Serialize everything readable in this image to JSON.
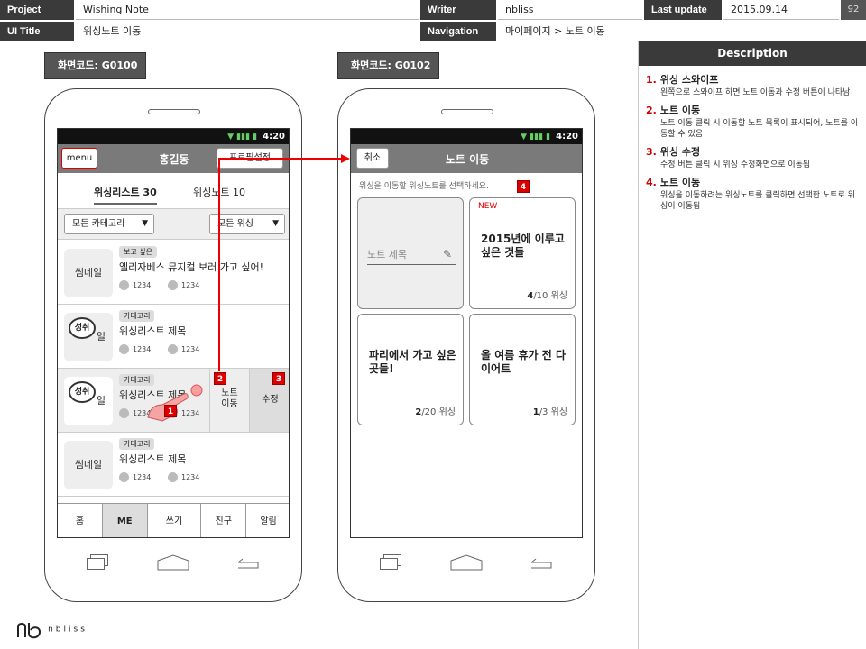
{
  "header": {
    "project_label": "Project",
    "project": "Wishing Note",
    "writer_label": "Writer",
    "writer": "nbliss",
    "lastupdate_label": "Last update",
    "lastupdate": "2015.09.14",
    "page": "92",
    "uititle_label": "UI Title",
    "uititle": "위싱노트 이동",
    "navigation_label": "Navigation",
    "navigation": "마이페이지 > 노트 이동"
  },
  "screen1": {
    "code": "화면코드: G0100",
    "time": "4:20",
    "menu": "menu",
    "name": "홍길동",
    "profile": "프로필설정",
    "tab1": "위싱리스트 30",
    "tab2": "위싱노트 10",
    "filter1": "모든 카테고리",
    "filter2": "모든 위싱",
    "rows": [
      {
        "thumb": "썸네일",
        "tag": "보고 싶은",
        "title": "엘리자베스 뮤지컬 보러 가고 싶어!",
        "c1": "1234",
        "c2": "1234"
      },
      {
        "thumb": "일",
        "badge": "성취",
        "tag": "카테고리",
        "title": "위싱리스트 제목",
        "c1": "1234",
        "c2": "1234"
      },
      {
        "thumb": "일",
        "badge": "성취",
        "tag": "카테고리",
        "title": "위싱리스트 제목",
        "c1": "1234",
        "c2": "1234",
        "move": "노트\n이동",
        "edit": "수정"
      },
      {
        "thumb": "썸네일",
        "tag": "카테고리",
        "title": "위싱리스트 제목",
        "c1": "1234",
        "c2": "1234"
      }
    ],
    "nav": [
      "홈",
      "ME",
      "쓰기",
      "친구",
      "알림"
    ]
  },
  "screen2": {
    "code": "화면코드: G0102",
    "time": "4:20",
    "cancel": "취소",
    "title": "노트 이동",
    "hint": "위싱을 이동할 위싱노트를 선택하세요.",
    "new_note_placeholder": "노트 제목",
    "cards": [
      {
        "new": "NEW",
        "title": "2015년에 이루고 싶은 것들",
        "count": "4",
        "total": "/10 위싱"
      },
      {
        "title": "파리에서 가고 싶은 곳들!",
        "count": "2",
        "total": "/20 위싱"
      },
      {
        "title": "올 여름 휴가 전 다이어트",
        "count": "1",
        "total": "/3 위싱"
      }
    ]
  },
  "markers": [
    "1",
    "2",
    "3",
    "4"
  ],
  "description": {
    "title": "Description",
    "items": [
      {
        "n": "1.",
        "title": "위싱 스와이프",
        "text": "왼쪽으로 스와이프 하면 노트 이동과 수정 버튼이 나타남"
      },
      {
        "n": "2.",
        "title": "노트 이동",
        "text": "노트 이동 클릭 시 이동할 노트 목록이 표시되어, 노트를 이동할 수 있음"
      },
      {
        "n": "3.",
        "title": "위싱 수정",
        "text": "수정 버튼 클릭 시 위싱 수정화면으로 이동됨"
      },
      {
        "n": "4.",
        "title": "노트 이동",
        "text": "위싱을 이동하려는 위싱노트를 클릭하면 선택한 노트로 위싱이 이동됨"
      }
    ]
  },
  "logo": "nbliss",
  "colors": {
    "accent": "#d00000",
    "dark": "#3a3a3a",
    "titlebar": "#7a7a7a"
  }
}
